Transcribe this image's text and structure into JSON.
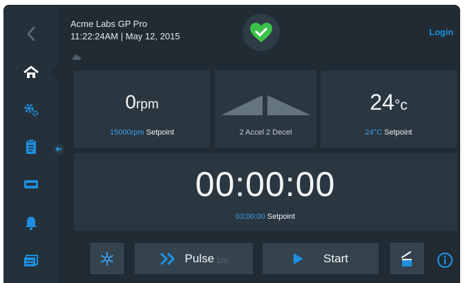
{
  "header": {
    "device_name": "Acme Labs GP Pro",
    "time_date": "11:22:24AM | May 12, 2015",
    "login_label": "Login"
  },
  "speed": {
    "value": "0",
    "unit": "rpm",
    "setpoint_value": "15000rpm",
    "setpoint_label": "Setpoint"
  },
  "accel": {
    "accel_label": "2 Accel",
    "decel_label": "2 Decel"
  },
  "temperature": {
    "value": "24",
    "unit": "°c",
    "setpoint_value": "24°C",
    "setpoint_label": "Setpoint"
  },
  "timer": {
    "value": "00:00:00",
    "setpoint_value": "03:00:00",
    "setpoint_label": "Setpoint"
  },
  "controls": {
    "pulse_label": "Pulse",
    "pulse_sub": "1m",
    "start_label": "Start"
  },
  "icons": {
    "back": "chevron-left-icon",
    "home": "home-icon",
    "settings": "gears-icon",
    "program": "clipboard-icon",
    "rotor": "rotor-icon",
    "alarm": "bell-icon",
    "history": "history-icon",
    "status": "heart-check-icon",
    "cloud": "cloud-icon",
    "snowflake": "snowflake-icon",
    "lid": "lid-icon",
    "info": "info-icon"
  },
  "colors": {
    "background": "#202b33",
    "panel": "#2a3640",
    "accent_blue": "#1e90e0",
    "status_green": "#3cc24a"
  }
}
